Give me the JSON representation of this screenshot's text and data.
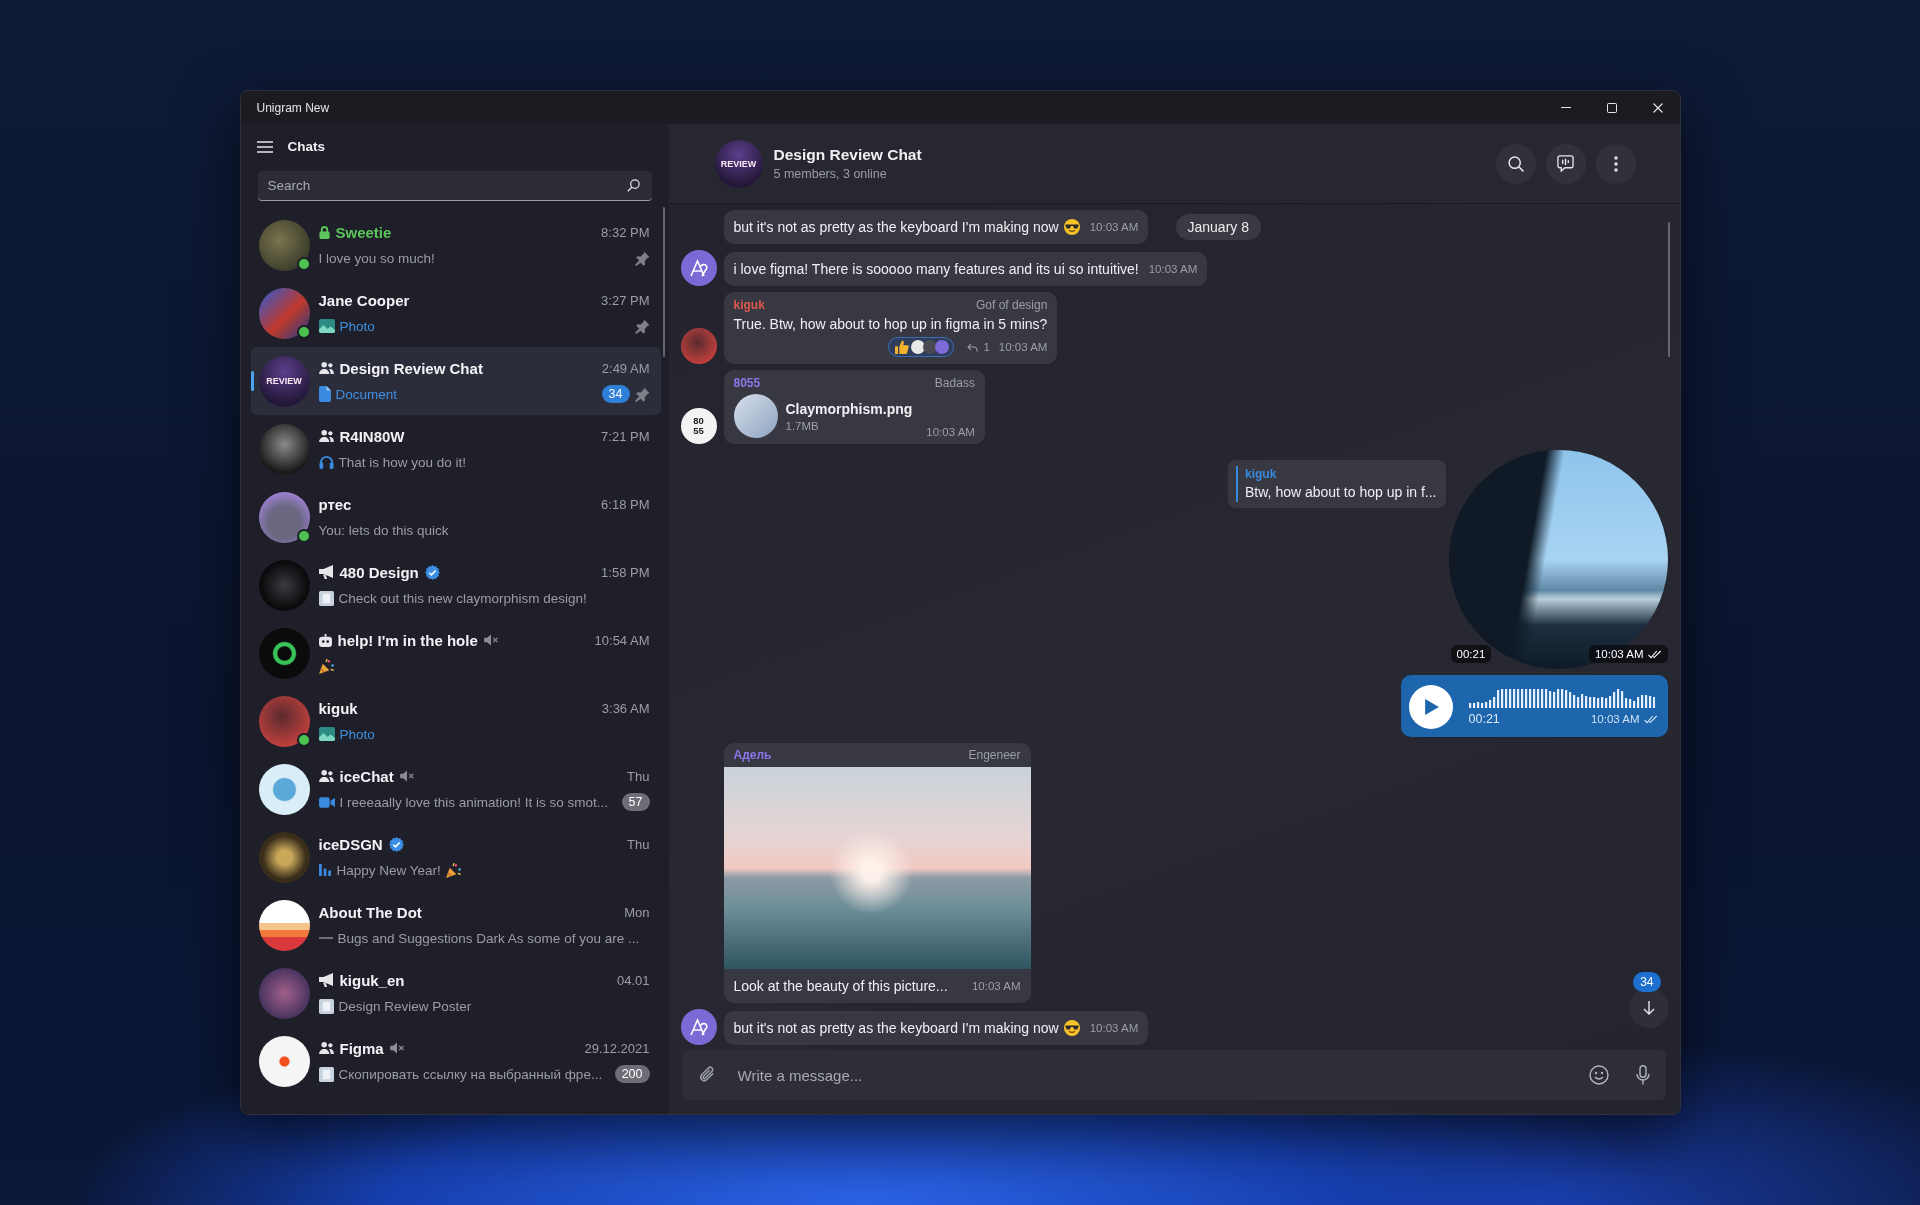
{
  "window": {
    "title": "Unigram New"
  },
  "sidebar": {
    "title": "Chats",
    "search": {
      "placeholder": "Search"
    },
    "chats": [
      {
        "name": "Sweetie",
        "kind": "secret",
        "verified": false,
        "muted": false,
        "online": true,
        "pinned": true,
        "selected": false,
        "time": "8:32 PM",
        "preview": {
          "text": "I love you so much!",
          "highlight": false
        }
      },
      {
        "name": "Jane Cooper",
        "kind": "user",
        "verified": false,
        "muted": false,
        "online": true,
        "pinned": true,
        "selected": false,
        "time": "3:27 PM",
        "preview": {
          "kind": "photo",
          "text": "Photo",
          "highlight": true
        }
      },
      {
        "name": "Design Review Chat",
        "kind": "group",
        "avatar_text": "REVIEW",
        "verified": false,
        "muted": false,
        "online": false,
        "pinned": true,
        "selected": true,
        "time": "2:49 AM",
        "preview": {
          "kind": "document",
          "text": "Document",
          "highlight": true
        },
        "unread": "34"
      },
      {
        "name": "R4IN80W",
        "kind": "group",
        "verified": false,
        "muted": false,
        "online": false,
        "pinned": false,
        "selected": false,
        "time": "7:21 PM",
        "preview": {
          "kind": "audio",
          "text": "That is how you do it!",
          "highlight": false
        }
      },
      {
        "name": "ртес",
        "kind": "user",
        "verified": false,
        "muted": false,
        "online": true,
        "pinned": false,
        "selected": false,
        "time": "6:18 PM",
        "preview": {
          "text": "You: lets do this quick",
          "highlight": false
        }
      },
      {
        "name": "480 Design",
        "kind": "channel",
        "verified": true,
        "muted": false,
        "online": false,
        "pinned": false,
        "selected": false,
        "time": "1:58 PM",
        "preview": {
          "kind": "image",
          "text": "Check out this new claymorphism design!",
          "highlight": false
        }
      },
      {
        "name": "help! I'm in the hole",
        "kind": "bot",
        "verified": false,
        "muted": true,
        "online": false,
        "pinned": false,
        "selected": false,
        "time": "10:54 AM",
        "preview": {
          "kind": "party"
        }
      },
      {
        "name": "kiguk",
        "kind": "user",
        "verified": false,
        "muted": false,
        "online": true,
        "pinned": false,
        "selected": false,
        "time": "3:36 AM",
        "preview": {
          "kind": "photo",
          "text": "Photo",
          "highlight": true
        }
      },
      {
        "name": "iceChat",
        "kind": "group",
        "verified": false,
        "muted": true,
        "online": false,
        "pinned": false,
        "selected": false,
        "time": "Thu",
        "preview": {
          "kind": "video",
          "text": "I reeeaally love this animation! It is so smot...",
          "highlight": false
        },
        "unread": "57"
      },
      {
        "name": "iceDSGN",
        "kind": "user",
        "verified": true,
        "muted": false,
        "online": false,
        "pinned": false,
        "selected": false,
        "time": "Thu",
        "preview": {
          "kind": "chart",
          "text": "Happy New Year!",
          "emoji": true,
          "highlight": false
        }
      },
      {
        "name": "About The Dot",
        "kind": "user",
        "verified": false,
        "muted": false,
        "online": false,
        "pinned": false,
        "selected": false,
        "time": "Mon",
        "preview": {
          "kind": "line",
          "text": "Bugs and Suggestions Dark As some of you are ...",
          "highlight": false
        }
      },
      {
        "name": "kiguk_en",
        "kind": "channel",
        "verified": false,
        "muted": false,
        "online": false,
        "pinned": false,
        "selected": false,
        "time": "04.01",
        "preview": {
          "kind": "image",
          "text": "Design Review Poster",
          "highlight": false
        }
      },
      {
        "name": "Figma",
        "kind": "group",
        "verified": false,
        "muted": true,
        "online": false,
        "pinned": false,
        "selected": false,
        "time": "29.12.2021",
        "preview": {
          "kind": "image",
          "text": "Скопировать ссылку на выбранный фре...",
          "highlight": false
        },
        "unread": "200"
      }
    ]
  },
  "chat": {
    "header": {
      "title": "Design Review Chat",
      "subtitle": "5 members, 3 online",
      "avatar_text": "REVIEW"
    },
    "date_badge": "January 8",
    "messages": [
      {
        "kind": "text",
        "outgoing": false,
        "text": "but it's not as pretty as the keyboard I'm making now",
        "emoji": true,
        "time": "10:03 AM"
      },
      {
        "kind": "text",
        "outgoing": false,
        "avatar": {
          "kind": "logo"
        },
        "text": "i love figma! There is sooooo many features and its ui so intuitive!",
        "time": "10:03 AM"
      },
      {
        "kind": "text",
        "outgoing": false,
        "avatar": {
          "kind": "photo"
        },
        "sender": {
          "name": "kiguk",
          "color": "#e0574f"
        },
        "title": "Gof of design",
        "text": "True. Btw, how about to hop up in figma in 5 mins?",
        "reaction": {
          "kind": "thumbs-up",
          "reactors": [
            {
              "kind": "text"
            },
            {
              "kind": "photo"
            },
            {
              "kind": "logo"
            }
          ]
        },
        "replies": "1",
        "time": "10:03 AM"
      },
      {
        "kind": "file",
        "outgoing": false,
        "avatar": {
          "kind": "text",
          "lines": [
            "80",
            "55"
          ]
        },
        "sender": {
          "name": "8055",
          "color": "#8b76e8"
        },
        "title": "Badass",
        "file": {
          "name": "Claymorphism.png",
          "size": "1.7MB"
        },
        "time": "10:03 AM"
      },
      {
        "kind": "round_video",
        "outgoing": true,
        "reply": {
          "sender": "kiguk",
          "text": "Btw, how about to hop up in f..."
        },
        "duration": "00:21",
        "time": "10:03 AM",
        "read": true
      },
      {
        "kind": "voice",
        "outgoing": true,
        "duration": "00:21",
        "time": "10:03 AM",
        "read": true
      },
      {
        "kind": "photo",
        "outgoing": false,
        "sender": {
          "name": "Адель",
          "color": "#8b76e8"
        },
        "title": "Engeneer",
        "caption": "Look at the beauty of this picture...",
        "time": "10:03 AM"
      },
      {
        "kind": "text",
        "outgoing": false,
        "avatar": {
          "kind": "logo"
        },
        "text": "but it's not as pretty as the keyboard I'm making now",
        "emoji": true,
        "time": "10:03 AM"
      }
    ],
    "scroll_down": {
      "unread": "34"
    },
    "composer": {
      "placeholder": "Write a message..."
    }
  }
}
